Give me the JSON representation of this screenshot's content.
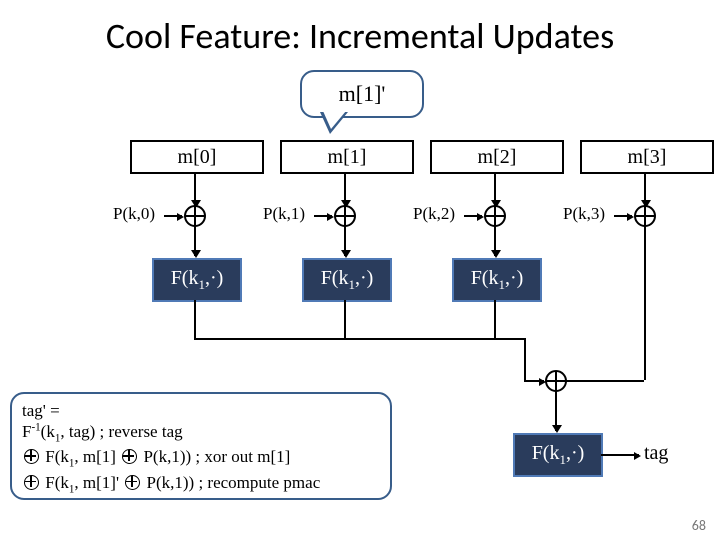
{
  "title": "Cool Feature: Incremental Updates",
  "callout": "m[1]'",
  "blocks": [
    {
      "m": "m[0]",
      "p": "P(k,0)",
      "f": "F(k1,·)"
    },
    {
      "m": "m[1]",
      "p": "P(k,1)",
      "f": "F(k1,·)"
    },
    {
      "m": "m[2]",
      "p": "P(k,2)",
      "f": "F(k1,·)"
    },
    {
      "m": "m[3]",
      "p": "P(k,3)",
      "f": null
    }
  ],
  "final_f": "F(k1,·)",
  "tag_label": "tag",
  "annot": {
    "line1": "tag' =",
    "line2_pre": "F",
    "line2_sup": "-1",
    "line2_rest": "(k1, tag) ; reverse tag",
    "line3": " F(k1, m[1] ⊕ P(k,1))  ; xor out m[1]",
    "line4": " F(k1, m[1]' ⊕ P(k,1)) ; recompute pmac"
  },
  "slide_number": "68",
  "chart_data": {
    "type": "diagram",
    "description": "PMAC incremental-update diagram",
    "columns": [
      {
        "input": "m[0]",
        "pad": "P(k,0)",
        "xor": true,
        "prf": "F(k1,·)"
      },
      {
        "input": "m[1]",
        "pad": "P(k,1)",
        "xor": true,
        "prf": "F(k1,·)",
        "updated_input": "m[1]'"
      },
      {
        "input": "m[2]",
        "pad": "P(k,2)",
        "xor": true,
        "prf": "F(k1,·)"
      },
      {
        "input": "m[3]",
        "pad": "P(k,3)",
        "xor": true,
        "prf": null
      }
    ],
    "combine": {
      "op": "xor",
      "then": "F(k1,·)",
      "output": "tag"
    },
    "update_rule": "tag' = F^{-1}(k1, tag) ⊕ F(k1, m[1] ⊕ P(k,1)) ⊕ F(k1, m[1]' ⊕ P(k,1))"
  }
}
